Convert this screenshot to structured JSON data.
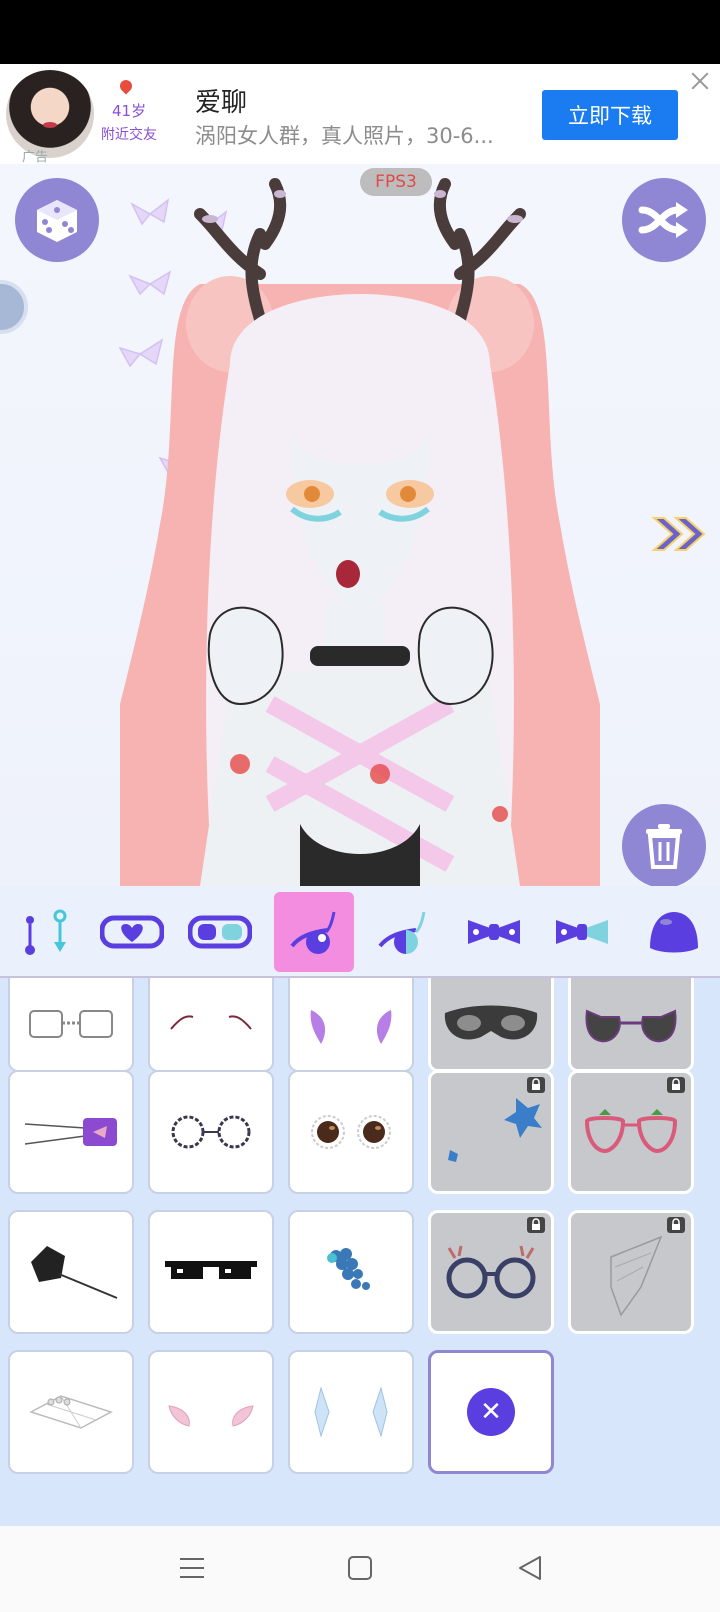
{
  "ad": {
    "label": "广告",
    "age": "41岁",
    "nearby": "附近交友",
    "title": "爱聊",
    "description": "涡阳女人群，真人照片，30-6...",
    "download_label": "立即下载"
  },
  "preview": {
    "fps_label": "FPS3"
  },
  "category_tabs": [
    {
      "icon": "earring-icon",
      "active": false
    },
    {
      "icon": "mask-heart-icon",
      "active": false
    },
    {
      "icon": "mask-half-icon",
      "active": false
    },
    {
      "icon": "face-accessory-icon",
      "active": true
    },
    {
      "icon": "face-accessory-alt-icon",
      "active": false
    },
    {
      "icon": "bow-icon",
      "active": false
    },
    {
      "icon": "bow-alt-icon",
      "active": false
    },
    {
      "icon": "hat-icon",
      "active": false
    }
  ],
  "items": [
    {
      "icon": "square-glasses-icon",
      "state": "free"
    },
    {
      "icon": "brow-lines-icon",
      "state": "free"
    },
    {
      "icon": "purple-shells-icon",
      "state": "free"
    },
    {
      "icon": "dark-mask-icon",
      "state": "video"
    },
    {
      "icon": "cat-glasses-icon",
      "state": "video"
    },
    {
      "icon": "purple-eyepatch-icon",
      "state": "free"
    },
    {
      "icon": "thorn-glasses-icon",
      "state": "free"
    },
    {
      "icon": "round-sunglasses-icon",
      "state": "free"
    },
    {
      "icon": "blue-leaf-icon",
      "state": "locked"
    },
    {
      "icon": "strawberry-glasses-icon",
      "state": "locked"
    },
    {
      "icon": "spiderweb-eyepatch-icon",
      "state": "free"
    },
    {
      "icon": "pixel-sunglasses-icon",
      "state": "free"
    },
    {
      "icon": "berry-cluster-icon",
      "state": "free"
    },
    {
      "icon": "antler-glasses-icon",
      "state": "locked"
    },
    {
      "icon": "lace-veil-icon",
      "state": "locked"
    },
    {
      "icon": "lace-face-icon",
      "state": "free"
    },
    {
      "icon": "pink-lace-icon",
      "state": "free"
    },
    {
      "icon": "ice-crystal-icon",
      "state": "free"
    },
    {
      "icon": "remove-icon",
      "state": "none"
    }
  ],
  "colors": {
    "accent": "#8f86d4",
    "active_tab": "#f28ddf",
    "icon_purple": "#5a3ee0",
    "download_blue": "#1a7cf0"
  }
}
